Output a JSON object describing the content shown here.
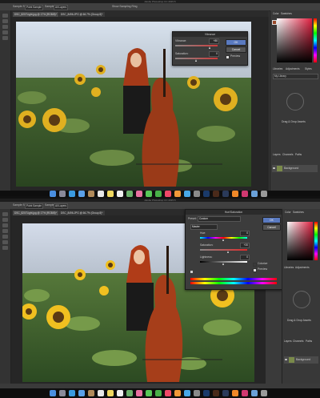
{
  "top": {
    "app_title": "Adobe Photoshop CC 2015.5",
    "options": {
      "sample_size_label": "Sample Size:",
      "sample_size_value": "Point Sample",
      "sample_label": "Sample:",
      "sample_value": "All Layers",
      "show_ring_label": "Show Sampling Ring"
    },
    "tabs": [
      "DSC_8207Light.jpg @ 17% (RGB/8)*",
      "DSC_8496.JPG @ 66.7% (Group 8)*"
    ],
    "panel_tabs": [
      "Color",
      "Swatches",
      "Libraries",
      "Adjustments",
      "Styles"
    ],
    "library_name": "My Library",
    "drag_drop": "Drag & Drop Assets",
    "layers_tabs": [
      "Layers",
      "Channels",
      "Paths"
    ],
    "layer_name": "Background",
    "dialog": {
      "title": "Vibrance",
      "vibrance_label": "Vibrance:",
      "vibrance_value": "+80",
      "saturation_label": "Saturation:",
      "saturation_value": "0",
      "ok": "OK",
      "cancel": "Cancel",
      "preview": "Preview"
    }
  },
  "bottom": {
    "app_title": "Adobe Photoshop CC 2015.5",
    "options": {
      "sample_size_label": "Sample Size:",
      "sample_size_value": "Point Sample",
      "sample_label": "Sample:",
      "sample_value": "All Layers"
    },
    "tabs": [
      "DSC_8207Light.jpg @ 17% (RGB/8)*",
      "DSC_8496.JPG @ 66.7% (Group 8)*"
    ],
    "panel_tabs": [
      "Color",
      "Swatches",
      "Libraries",
      "Adjustments",
      "Styles"
    ],
    "drag_drop": "Drag & Drop Assets",
    "layers_tabs": [
      "Layers",
      "Channels",
      "Paths"
    ],
    "layer_name": "Background",
    "dialog": {
      "title": "Hue/Saturation",
      "preset_label": "Preset:",
      "preset_value": "Custom",
      "channel_value": "Master",
      "hue_label": "Hue:",
      "hue_value": "0",
      "saturation_label": "Saturation:",
      "saturation_value": "+20",
      "lightness_label": "Lightness:",
      "lightness_value": "0",
      "ok": "OK",
      "cancel": "Cancel",
      "colorize": "Colorize",
      "preview": "Preview"
    }
  },
  "dock_icons": [
    "finder-icon",
    "launchpad-icon",
    "safari-icon",
    "mail-icon",
    "contacts-icon",
    "calendar-icon",
    "notes-icon",
    "reminders-icon",
    "maps-icon",
    "photos-icon",
    "messages-icon",
    "facetime-icon",
    "music-icon",
    "ibooks-icon",
    "appstore-icon",
    "preferences-icon",
    "photoshop-icon",
    "bridge-icon",
    "lightroom-icon",
    "illustrator-icon",
    "indesign-icon",
    "folder-icon",
    "trash-icon"
  ],
  "dock_colors": [
    "#4a8fe0",
    "#8a8a9a",
    "#3a9ae0",
    "#5aa0e8",
    "#b08a5a",
    "#e8e8e8",
    "#f0d860",
    "#f0f0f0",
    "#6ab06a",
    "#e870a0",
    "#58c858",
    "#48b048",
    "#f04868",
    "#f09838",
    "#48a8e8",
    "#8a8a8a",
    "#1a3a6a",
    "#4a2a1a",
    "#2a3a5a",
    "#f08828",
    "#d03870",
    "#6aa0d8",
    "#9a9a9a"
  ]
}
